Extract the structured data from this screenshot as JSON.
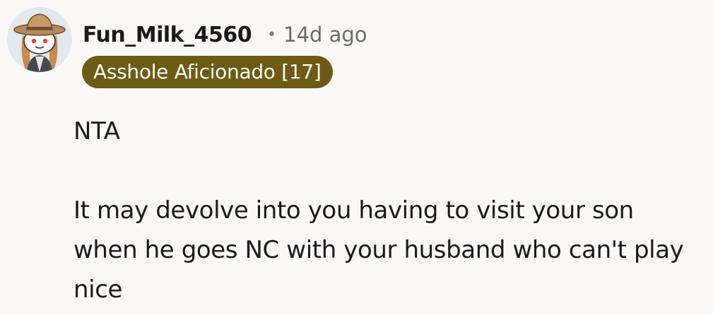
{
  "comment": {
    "author": "Fun_Milk_4560",
    "separator": "•",
    "timestamp": "14d ago",
    "flair": {
      "label": "Asshole Aficionado [17]",
      "color": "#6d5b14"
    },
    "avatar_icon": "cowboy-snoo-avatar-icon",
    "paragraphs": [
      "NTA",
      "It may devolve into you having to visit your son when he goes NC with your husband who can't play nice"
    ]
  }
}
